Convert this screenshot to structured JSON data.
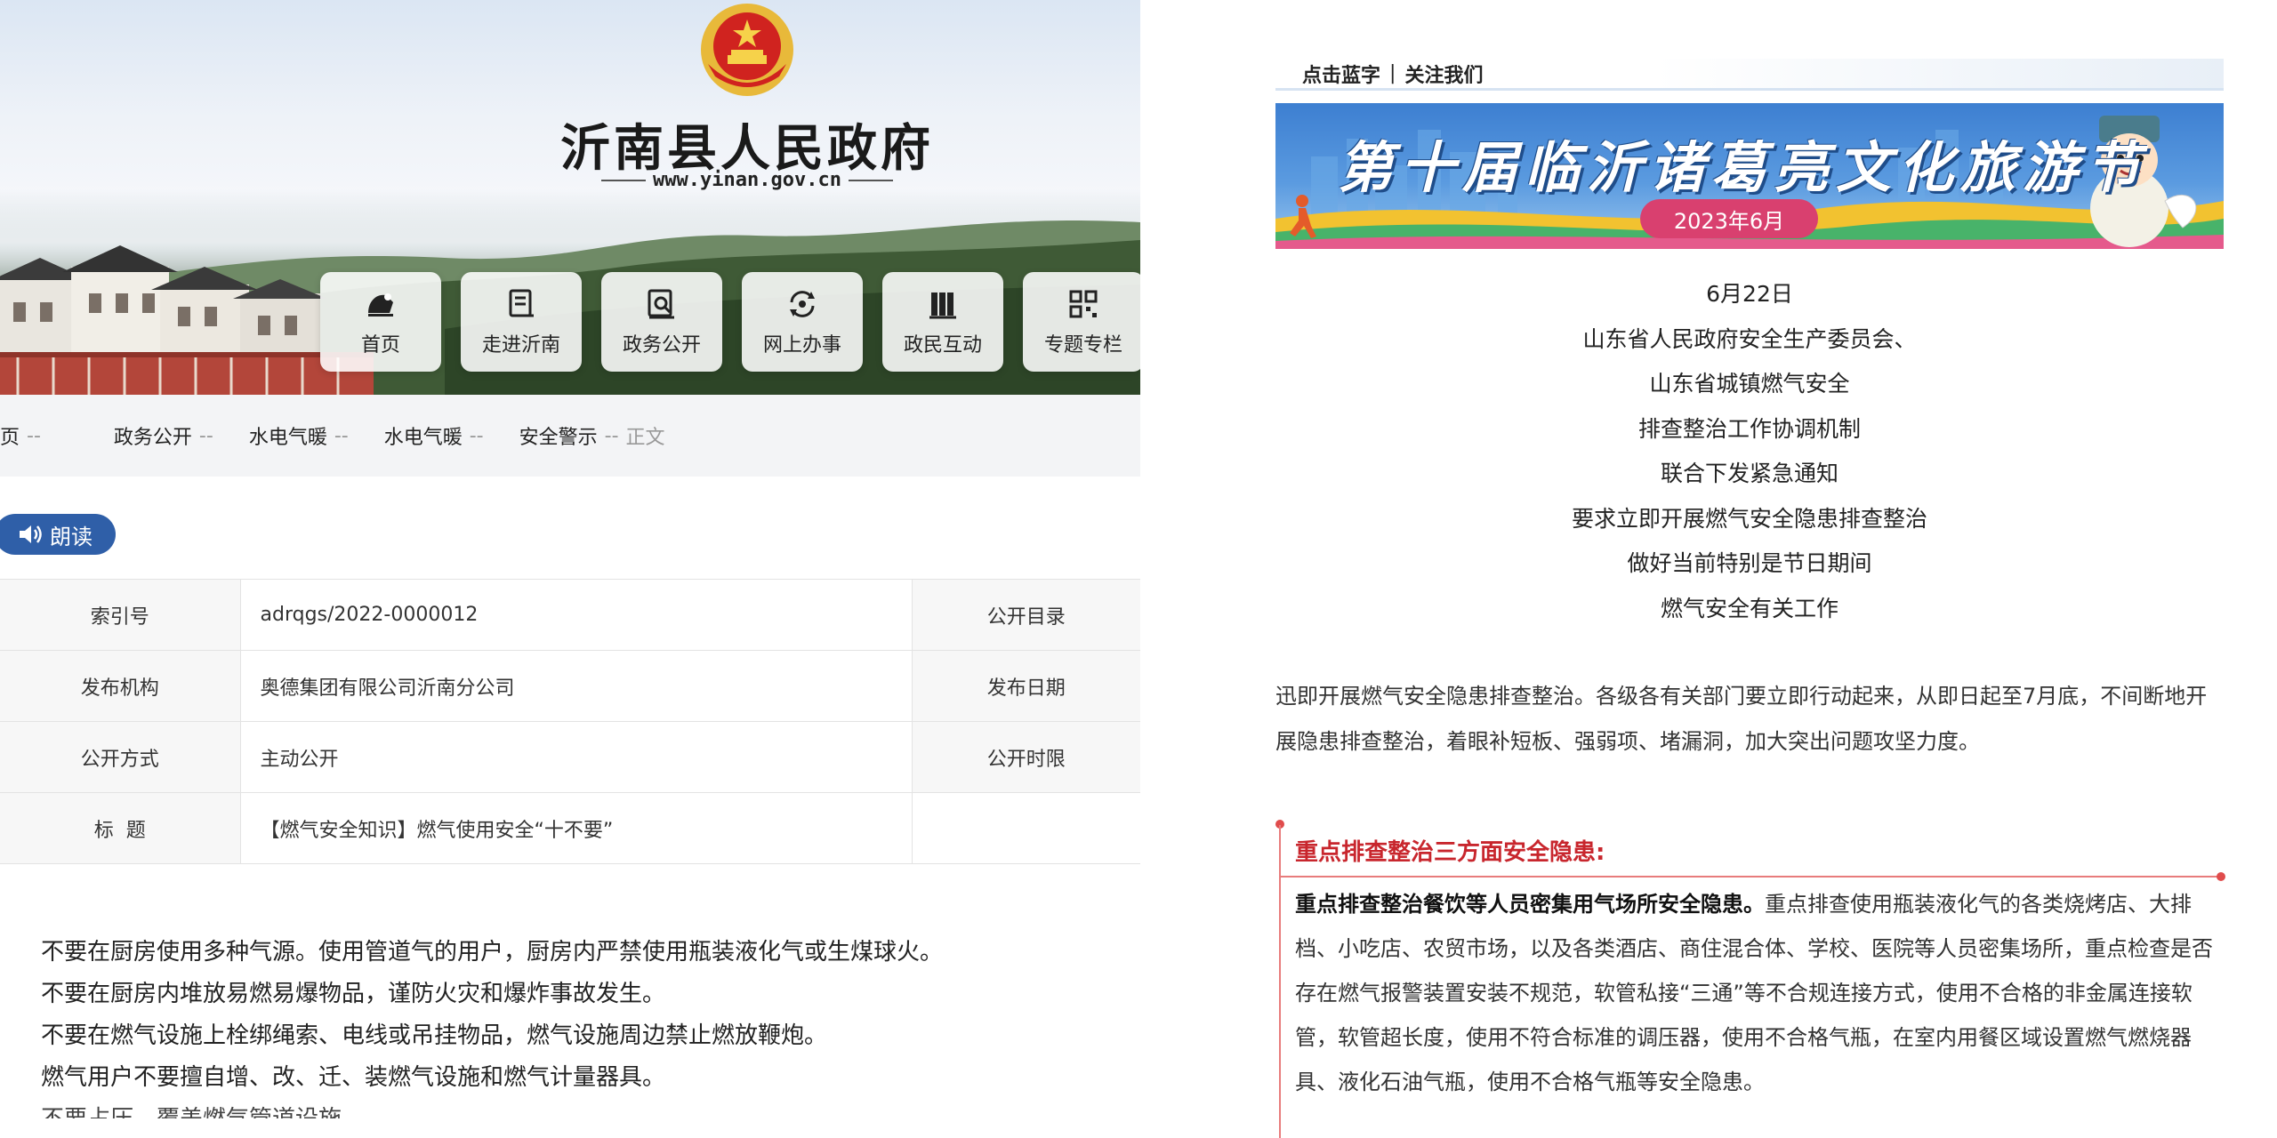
{
  "site": {
    "title": "沂南县人民政府",
    "url": "www.yinan.gov.cn"
  },
  "nav": {
    "items": [
      {
        "label": "首页",
        "icon": "home-icon"
      },
      {
        "label": "走进沂南",
        "icon": "document-icon"
      },
      {
        "label": "政务公开",
        "icon": "search-document-icon"
      },
      {
        "label": "网上办事",
        "icon": "refresh-icon"
      },
      {
        "label": "政民互动",
        "icon": "books-icon"
      },
      {
        "label": "专题专栏",
        "icon": "grid-icon"
      }
    ]
  },
  "breadcrumb": {
    "first": "页",
    "items": [
      "政务公开",
      "水电气暖",
      "水电气暖",
      "安全警示"
    ],
    "separator": "--",
    "current": "正文"
  },
  "read_button": {
    "label": "朗读"
  },
  "info_table": {
    "rows": [
      {
        "label": "索引号",
        "value": "adrqgs/2022-0000012",
        "label2": "公开目录"
      },
      {
        "label": "发布机构",
        "value": "奥德集团有限公司沂南分公司",
        "label2": "发布日期"
      },
      {
        "label": "公开方式",
        "value": "主动公开",
        "label2": "公开时限"
      },
      {
        "label": "标  题",
        "value": "【燃气安全知识】燃气使用安全“十不要”",
        "label2": ""
      }
    ]
  },
  "body": {
    "lines": [
      "不要在厨房使用多种气源。使用管道气的用户，厨房内严禁使用瓶装液化气或生煤球火。",
      "不要在厨房内堆放易燃易爆物品，谨防火灾和爆炸事故发生。",
      "不要在燃气设施上栓绑绳索、电线或吊挂物品，燃气设施周边禁止燃放鞭炮。",
      "燃气用户不要擅自增、改、迁、装燃气设施和燃气计量器具。",
      "不要占压、覆盖燃气管道设施"
    ]
  },
  "article": {
    "follow_bar": {
      "left": "点击蓝字",
      "separator": "|",
      "right": "关注我们"
    },
    "banner": {
      "title": "第十届临沂诸葛亮文化旅游节",
      "date": "2023年6月"
    },
    "notice_lines": [
      "6月22日",
      "山东省人民政府安全生产委员会、",
      "山东省城镇燃气安全",
      "排查整治工作协调机制",
      "联合下发紧急通知",
      "要求立即开展燃气安全隐患排查整治",
      "做好当前特别是节日期间",
      "燃气安全有关工作"
    ],
    "paragraph": "迅即开展燃气安全隐患排查整治。各级各有关部门要立即行动起来，从即日起至7月底，不间断地开展隐患排查整治，着眼补短板、强弱项、堵漏洞，加大突出问题攻坚力度。",
    "section": {
      "heading": "重点排查整治三方面安全隐患:",
      "lead": "重点排查整治餐饮等人员密集用气场所安全隐患。",
      "text": "重点排查使用瓶装液化气的各类烧烤店、大排档、小吃店、农贸市场，以及各类酒店、商住混合体、学校、医院等人员密集场所，重点检查是否存在燃气报警装置安装不规范，软管私接“三通”等不合规连接方式，使用不合格的非金属连接软管，软管超长度，使用不符合标准的调压器，使用不合格气瓶，在室内用餐区域设置燃气燃烧器具、液化石油气瓶，使用不合格气瓶等安全隐患。"
    }
  },
  "colors": {
    "read_button": "#2f5fa8",
    "section_red": "#c8262d",
    "banner_blue": "#3d7fd1",
    "date_pill": "#d9406f"
  }
}
